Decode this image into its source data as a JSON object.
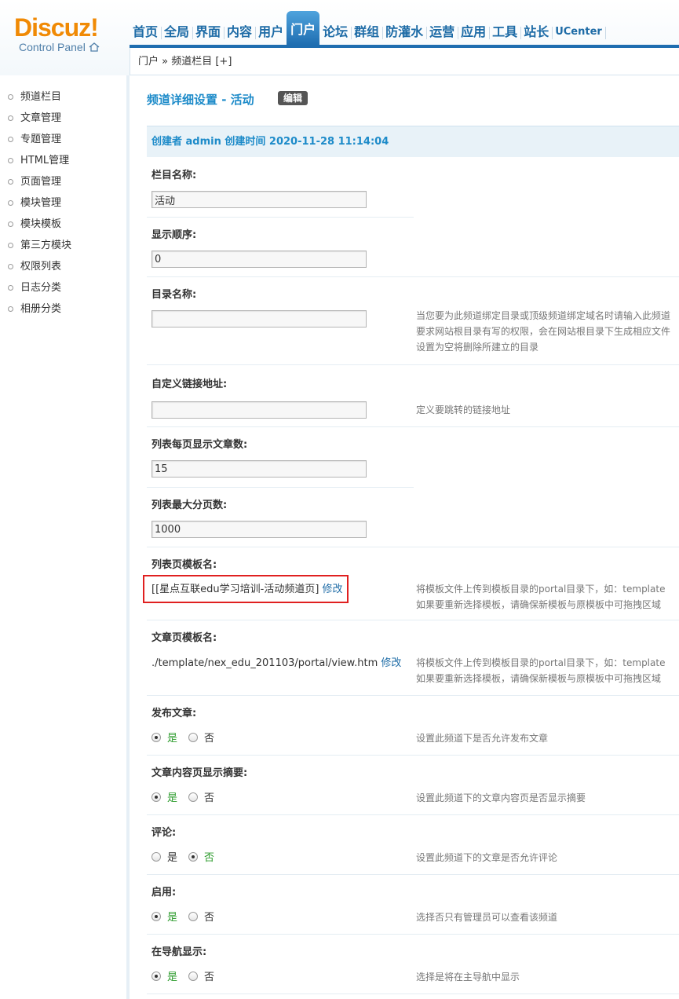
{
  "logo": {
    "main": "Discuz!",
    "sub": "Control Panel"
  },
  "nav": [
    "首页",
    "全局",
    "界面",
    "内容",
    "用户",
    "门户",
    "论坛",
    "群组",
    "防灌水",
    "运营",
    "应用",
    "工具",
    "站长",
    "UCenter"
  ],
  "nav_active": "门户",
  "breadcrumb": "门户 » 频道栏目 [+]",
  "sidebar": [
    "频道栏目",
    "文章管理",
    "专题管理",
    "HTML管理",
    "页面管理",
    "模块管理",
    "模块模板",
    "第三方模块",
    "权限列表",
    "日志分类",
    "相册分类"
  ],
  "page_title": "频道详细设置 - 活动",
  "edit_label": "编辑",
  "meta": "创建者 admin 创建时间 2020-11-28 11:14:04",
  "fields": {
    "name": {
      "label": "栏目名称:",
      "value": "活动"
    },
    "order": {
      "label": "显示顺序:",
      "value": "0"
    },
    "dir": {
      "label": "目录名称:",
      "value": "",
      "tip1": "当您要为此频道绑定目录或顶级频道绑定域名时请输入此频道",
      "tip2": "要求网站根目录有写的权限，会在网站根目录下生成相应文件",
      "tip3": "设置为空将删除所建立的目录"
    },
    "url": {
      "label": "自定义链接地址:",
      "value": "",
      "tip": "定义要跳转的链接地址"
    },
    "per_page": {
      "label": "列表每页显示文章数:",
      "value": "15"
    },
    "max_pages": {
      "label": "列表最大分页数:",
      "value": "1000"
    },
    "list_tpl": {
      "label": "列表页模板名:",
      "value": "[[星点互联edu学习培训-活动频道页]",
      "link": "修改",
      "tip1": "将模板文件上传到模板目录的portal目录下，如：template",
      "tip2": "如果要重新选择模板，请确保新模板与原模板中可拖拽区域"
    },
    "view_tpl": {
      "label": "文章页模板名:",
      "value": "./template/nex_edu_201103/portal/view.htm",
      "link": "修改",
      "tip1": "将模板文件上传到模板目录的portal目录下，如：template",
      "tip2": "如果要重新选择模板，请确保新模板与原模板中可拖拽区域"
    },
    "publish": {
      "label": "发布文章:",
      "tip": "设置此频道下是否允许发布文章",
      "selected": "yes"
    },
    "summary": {
      "label": "文章内容页显示摘要:",
      "tip": "设置此频道下的文章内容页是否显示摘要",
      "selected": "yes"
    },
    "comment": {
      "label": "评论:",
      "tip": "设置此频道下的文章是否允许评论",
      "selected": "no"
    },
    "enable": {
      "label": "启用:",
      "tip": "选择否只有管理员可以查看该频道",
      "selected": "yes"
    },
    "shownav": {
      "label": "在导航显示:",
      "tip": "选择是将在主导航中显示",
      "selected": "yes"
    }
  },
  "radio_yes": "是",
  "radio_no": "否",
  "colors": {
    "accent": "#1e6db0",
    "title": "#1d8bc9",
    "highlight": "#e02020",
    "logo": "#f08a05"
  }
}
